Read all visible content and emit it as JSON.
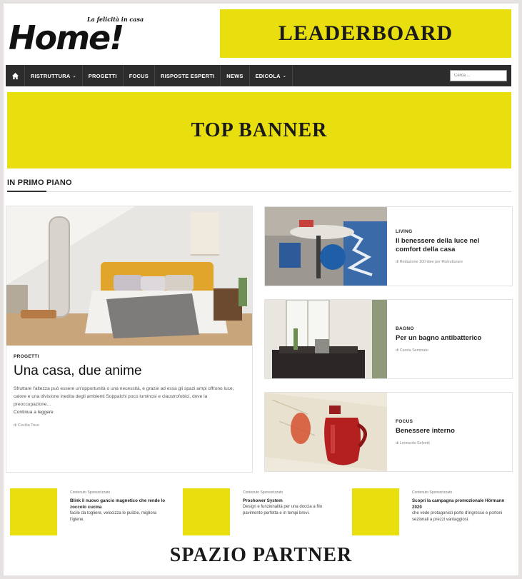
{
  "header": {
    "logo_text": "Home!",
    "logo_tagline": "La felicità in casa",
    "leaderboard_label": "LEADERBOARD"
  },
  "nav": {
    "items": [
      {
        "label": "RISTRUTTURA",
        "has_dropdown": true
      },
      {
        "label": "PROGETTI",
        "has_dropdown": false
      },
      {
        "label": "FOCUS",
        "has_dropdown": false
      },
      {
        "label": "RISPOSTE ESPERTI",
        "has_dropdown": false
      },
      {
        "label": "NEWS",
        "has_dropdown": false
      },
      {
        "label": "EDICOLA",
        "has_dropdown": true
      }
    ],
    "search_placeholder": "Cerca ..."
  },
  "top_banner_label": "TOP BANNER",
  "section": {
    "title": "IN PRIMO PIANO"
  },
  "main_article": {
    "category": "PROGETTI",
    "title": "Una casa, due anime",
    "excerpt": "Sfruttare l'altezza può essere un'opportunità o una necessità, e grazie ad essa gli spazi ampi offrono luce, calore e una divisione inedita degli ambienti Soppalchi poco luminosi e claustrofobici, dove la preoccupazione...",
    "read_more": "Continua a leggere",
    "byline": "di Cecilia Toso"
  },
  "side_articles": [
    {
      "category": "LIVING",
      "title": "Il benessere della luce nel comfort della casa",
      "byline": "di Redazione 100 idee per Ristrutturare"
    },
    {
      "category": "BAGNO",
      "title": "Per un bagno antibatterico",
      "byline": "di Carola Seminato"
    },
    {
      "category": "FOCUS",
      "title": "Benessere interno",
      "byline": "di Leonardo Selvetti"
    }
  ],
  "sponsored": [
    {
      "label": "Contenuto Sponsorizzato",
      "title": "Blink il nuovo gancio magnetico che rende lo zoccolo cucina",
      "desc": "facile da togliere, velocizza le pulizie, migliora l'igiene."
    },
    {
      "label": "Contenuto Sponsorizzato",
      "title": "Proshower System",
      "desc": "Design e funzionalità per una doccia a filo pavimento perfetta e in tempi brevi."
    },
    {
      "label": "Contenuto Sponsorizzato",
      "title": "Scopri la campagna promozionale Hörmann 2020",
      "desc": "che vede protagonisti porte d'ingresso e portoni sezionali a prezzi vantaggiosi."
    }
  ],
  "partner_label": "SPAZIO PARTNER",
  "colors": {
    "ad_yellow": "#e9df0f",
    "nav_dark": "#2c2c2c"
  },
  "icons": {
    "nav_home": "home-icon"
  }
}
